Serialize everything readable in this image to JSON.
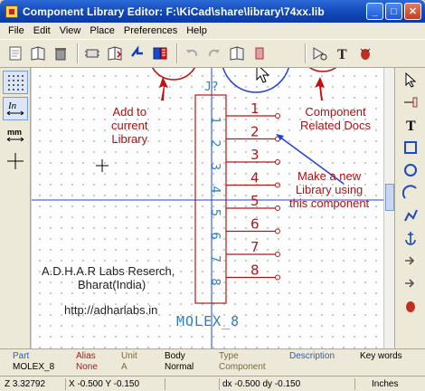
{
  "window": {
    "title": "Component Library Editor: F:\\KiCad\\share\\library\\74xx.lib",
    "buttons": {
      "minimize": "_",
      "maximize": "□",
      "close": "✕"
    }
  },
  "menu": [
    "File",
    "Edit",
    "View",
    "Place",
    "Preferences",
    "Help"
  ],
  "toolbar_icons": [
    "new-component-icon",
    "library-icon",
    "delete-icon",
    "load-component-icon",
    "import-icon",
    "save-to-library-icon",
    "new-library-icon",
    "undo-icon",
    "redo-icon",
    "properties-icon",
    "docs-icon",
    "text-icon",
    "delete-item-icon"
  ],
  "schematic": {
    "reference": "J?",
    "value": "MOLEX_8",
    "pins": [
      "1",
      "2",
      "3",
      "4",
      "5",
      "6",
      "7",
      "8"
    ],
    "pin_names": [
      "1",
      "2",
      "3",
      "4",
      "5",
      "6",
      "7",
      "8"
    ]
  },
  "annotations": {
    "add_library": [
      "Add to",
      "current",
      "Library"
    ],
    "docs": [
      "Component",
      "Related Docs"
    ],
    "new_library": [
      "Make a new",
      "Library using",
      "this component"
    ]
  },
  "credit": {
    "line1": "A.D.H.A.R Labs Reserch,",
    "line2": "Bharat(India)",
    "url": "http://adharlabs.in"
  },
  "info_bar": {
    "part_label": "Part",
    "part_value": "MOLEX_8",
    "alias_label": "Alias",
    "alias_value": "None",
    "unit_label": "Unit",
    "unit_value": "A",
    "body_label": "Body",
    "body_value": "Normal",
    "type_label": "Type",
    "type_value": "Component",
    "desc_label": "Description",
    "kw_label": "Key words"
  },
  "status_bar": {
    "zoom": "Z 3.32792",
    "cursor": "X -0.500  Y -0.150",
    "delta": "dx -0.500  dy -0.150",
    "units": "Inches"
  },
  "colors": {
    "body_red": "#b01818",
    "text_blue": "#2a7fbf",
    "annotation_red": "#b01010",
    "highlight_blue": "#2040e0"
  }
}
